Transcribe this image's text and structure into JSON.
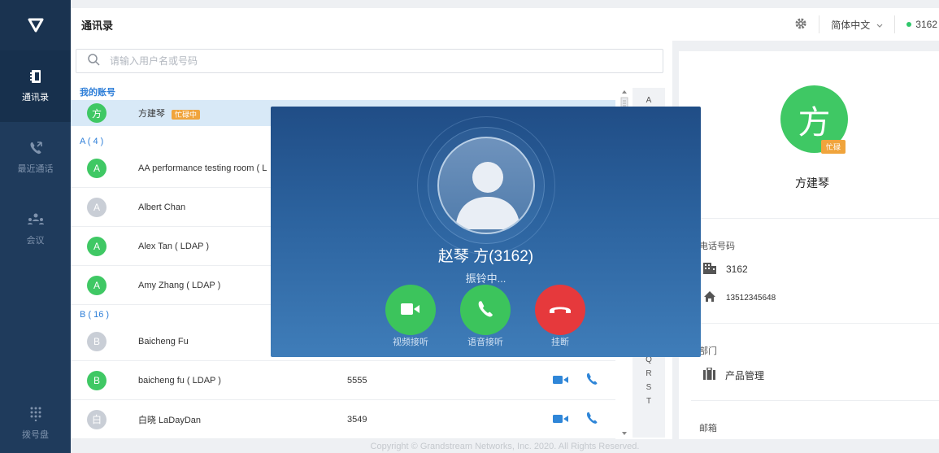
{
  "app": {
    "page_title": "通讯录",
    "footer": "Copyright © Grandstream Networks, Inc. 2020. All Rights Reserved."
  },
  "sidebar": {
    "items": [
      {
        "label": "通讯录",
        "icon": "contacts-icon",
        "active": true
      },
      {
        "label": "最近通话",
        "icon": "recent-calls-icon",
        "active": false
      },
      {
        "label": "会议",
        "icon": "meeting-icon",
        "active": false
      }
    ],
    "dialpad_label": "拨号盘"
  },
  "topbar": {
    "language": "简体中文",
    "extension": "3162"
  },
  "search": {
    "placeholder": "请输入用户名或号码"
  },
  "list": {
    "my_account_header": "我的账号",
    "me": {
      "avatar": "方",
      "name": "方建琴",
      "badge": "忙碌中"
    },
    "section_a": "A ( 4 )",
    "section_b": "B ( 16 )",
    "rows_a": [
      {
        "avatar": "A",
        "name": "AA performance testing room ( L",
        "color": "#3fc864"
      },
      {
        "avatar": "A",
        "name": "Albert Chan",
        "color": "#c9ced6"
      },
      {
        "avatar": "A",
        "name": "Alex Tan ( LDAP )",
        "color": "#3fc864"
      },
      {
        "avatar": "A",
        "name": "Amy Zhang ( LDAP )",
        "color": "#3fc864"
      }
    ],
    "rows_b": [
      {
        "avatar": "B",
        "name": "Baicheng Fu",
        "number": "",
        "color": "#c9ced6"
      },
      {
        "avatar": "B",
        "name": "baicheng fu ( LDAP )",
        "number": "5555",
        "color": "#3fc864"
      },
      {
        "avatar": "白",
        "name": "白晓 LaDayDan",
        "number": "3549",
        "color": "#c9ced6"
      }
    ]
  },
  "alphabet": [
    "A",
    "Q",
    "R",
    "S",
    "T"
  ],
  "detail": {
    "avatar": "方",
    "badge": "忙碌",
    "name": "方建琴",
    "phone_label": "电话号码",
    "work_number": "3162",
    "home_number": "13512345648",
    "dept_label": "部门",
    "dept": "产品管理",
    "email_label": "邮箱"
  },
  "call": {
    "caller": "赵琴 方(3162)",
    "status": "振铃中...",
    "video_label": "视频接听",
    "audio_label": "语音接听",
    "hangup_label": "挂断"
  }
}
